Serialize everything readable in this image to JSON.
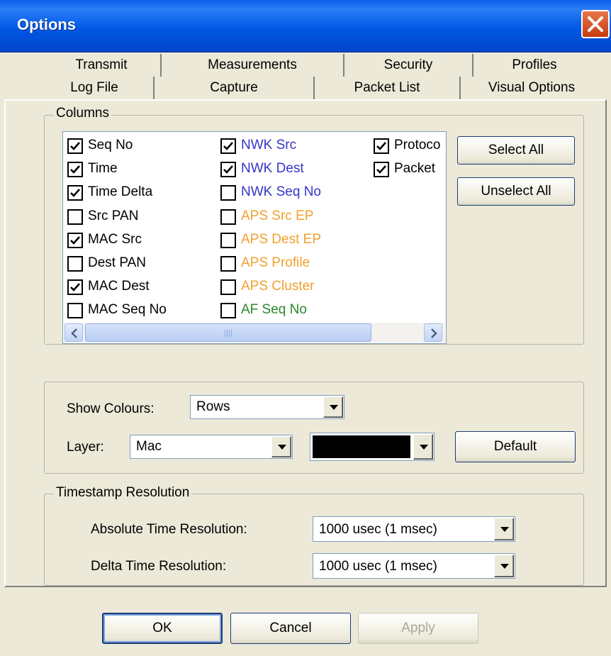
{
  "window": {
    "title": "Options"
  },
  "tabs": {
    "back_row": [
      "Transmit",
      "Measurements",
      "Security",
      "Profiles"
    ],
    "front_row": [
      "Log File",
      "Capture",
      "Packet List",
      "Visual Options"
    ],
    "active": "Packet List"
  },
  "columns": {
    "legend": "Columns",
    "items": [
      {
        "label": "Seq No",
        "checked": true,
        "color": "#000000"
      },
      {
        "label": "Time",
        "checked": true,
        "color": "#000000"
      },
      {
        "label": "Time Delta",
        "checked": true,
        "color": "#000000"
      },
      {
        "label": "Src PAN",
        "checked": false,
        "color": "#000000"
      },
      {
        "label": "MAC Src",
        "checked": true,
        "color": "#000000"
      },
      {
        "label": "Dest PAN",
        "checked": false,
        "color": "#000000"
      },
      {
        "label": "MAC Dest",
        "checked": true,
        "color": "#000000"
      },
      {
        "label": "MAC Seq No",
        "checked": false,
        "color": "#000000"
      },
      {
        "label": "NWK Src",
        "checked": true,
        "color": "#3535c8"
      },
      {
        "label": "NWK Dest",
        "checked": true,
        "color": "#3535c8"
      },
      {
        "label": "NWK Seq No",
        "checked": false,
        "color": "#3535c8"
      },
      {
        "label": "APS Src EP",
        "checked": false,
        "color": "#f0a030"
      },
      {
        "label": "APS Dest EP",
        "checked": false,
        "color": "#f0a030"
      },
      {
        "label": "APS Profile",
        "checked": false,
        "color": "#f0a030"
      },
      {
        "label": "APS Cluster",
        "checked": false,
        "color": "#f0a030"
      },
      {
        "label": "AF Seq No",
        "checked": false,
        "color": "#2a8a2a"
      },
      {
        "label": "Protoco",
        "checked": true,
        "color": "#000000"
      },
      {
        "label": "Packet",
        "checked": true,
        "color": "#000000"
      }
    ],
    "select_all": "Select All",
    "unselect_all": "Unselect All"
  },
  "colours": {
    "show_label": "Show Colours:",
    "show_value": "Rows",
    "layer_label": "Layer:",
    "layer_value": "Mac",
    "swatch_color": "#000000",
    "default_button": "Default"
  },
  "timestamp": {
    "legend": "Timestamp Resolution",
    "absolute_label": "Absolute Time Resolution:",
    "absolute_value": "1000 usec (1 msec)",
    "delta_label": "Delta Time Resolution:",
    "delta_value": "1000 usec (1 msec)"
  },
  "buttons": {
    "ok": "OK",
    "cancel": "Cancel",
    "apply": "Apply"
  }
}
